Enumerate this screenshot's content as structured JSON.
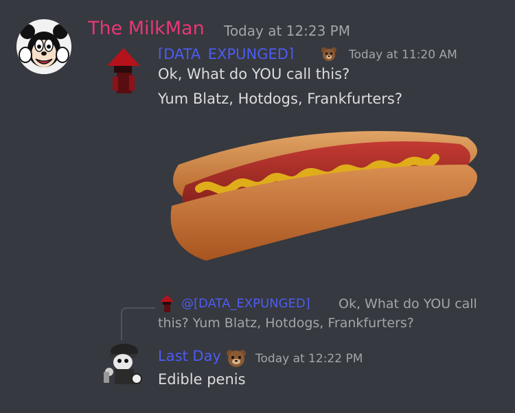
{
  "header": {
    "username": "The MilkMan",
    "timestamp": "Today at 12:23 PM",
    "username_color": "#e9367a"
  },
  "quoted_message": {
    "username": "[DATA_EXPUNGED]",
    "timestamp": "Today at 11:20 AM",
    "line1": "Ok, What do YOU call this?",
    "line2": "Yum Blatz, Hotdogs, Frankfurters?",
    "badge_icon": "bear-emoji-icon",
    "username_color": "#4e5cf2"
  },
  "reply_preview": {
    "mention": "@[DATA_EXPUNGED]",
    "text_line1": "Ok, What do YOU call",
    "text_line2": "this? Yum Blatz, Hotdogs, Frankfurters?"
  },
  "reply_message": {
    "username": "Last Day",
    "timestamp": "Today at 12:22 PM",
    "text": "Edible penis",
    "badge_icon": "bear-emoji-icon"
  },
  "attachment": {
    "icon": "hotdog-image"
  }
}
